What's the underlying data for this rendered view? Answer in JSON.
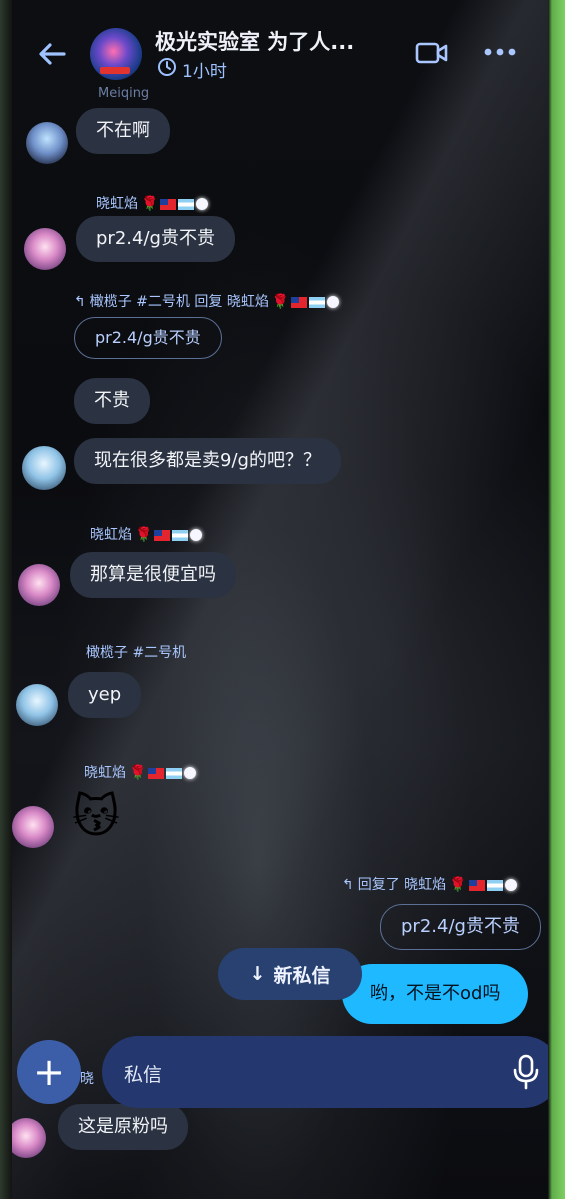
{
  "header": {
    "title": "极光实验室 为了人...",
    "subtitle": "1小时",
    "back_icon": "arrow-left-icon",
    "clock_icon": "clock-icon",
    "video_icon": "video-camera-icon",
    "more_icon": "more-horizontal-icon"
  },
  "messages": [
    {
      "sender": "Meiqing",
      "text": "不在啊"
    },
    {
      "sender": "晓虹焰",
      "text": "pr2.4/g贵不贵"
    },
    {
      "sender": "橄榄子 #二号机",
      "reply_line": "橄榄子 #二号机 回复 晓虹焰",
      "quoted": "pr2.4/g贵不贵",
      "text1": "不贵",
      "text2": "现在很多都是卖9/g的吧？？"
    },
    {
      "sender": "晓虹焰",
      "text": "那算是很便宜吗"
    },
    {
      "sender": "橄榄子 #二号机",
      "text": "yep"
    },
    {
      "sender": "晓虹焰",
      "sticker": "😽"
    },
    {
      "reply_line": "回复了 晓虹焰",
      "quoted": "pr2.4/g贵不贵",
      "text": "哟，不是不od吗"
    },
    {
      "sender": "晓",
      "text": "这是原粉吗"
    }
  ],
  "new_message_pill": {
    "arrow": "↓",
    "label": "新私信"
  },
  "composer": {
    "placeholder": "私信",
    "plus": "+",
    "mic_icon": "microphone-icon"
  },
  "colors": {
    "accent": "#1fb9ff",
    "bubble": "#2b3241",
    "name": "#a9c6ff",
    "input": "#24386f"
  }
}
